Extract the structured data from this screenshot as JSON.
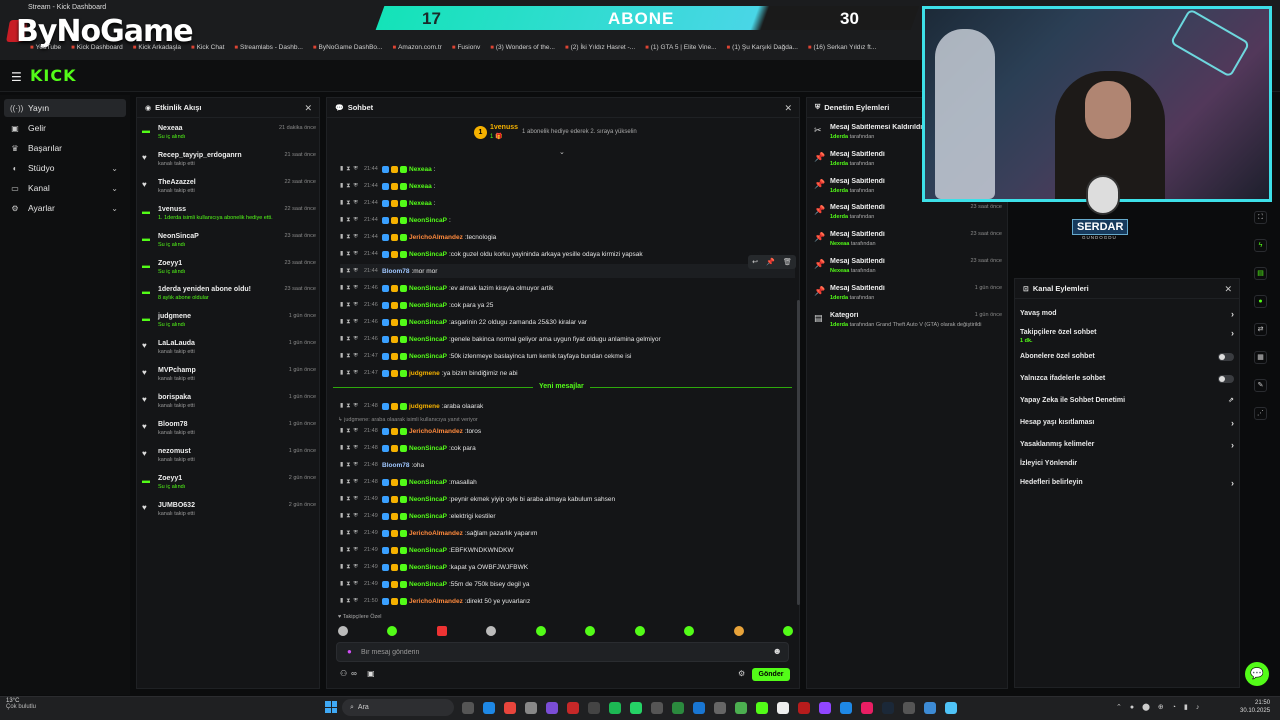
{
  "browser": {
    "tab_title": "Stream - Kick Dashboard",
    "logo_text": "ByNoGame",
    "bookmarks": [
      "YouTube",
      "Kick Dashboard",
      "Kick Arkadaşla",
      "Kick Chat",
      "Streamlabs - Dashb...",
      "ByNoGame DashBo...",
      "Amazon.com.tr",
      "Fusionv",
      "(3) Wonders of the...",
      "(2) İki Yıldız Hasret -...",
      "(1) GTA 5 | Elite Vine...",
      "(1) Şu Karşıki Dağda...",
      "(16) Serkan Yıldız ft..."
    ]
  },
  "sub_goal": {
    "current": "17",
    "label": "ABONE",
    "target": "30"
  },
  "kick": {
    "logo": "KICK"
  },
  "nav": {
    "items": [
      {
        "label": "Yayın",
        "icon": "broadcast-icon",
        "active": true
      },
      {
        "label": "Gelir",
        "icon": "wallet-icon"
      },
      {
        "label": "Başarılar",
        "icon": "trophy-icon"
      },
      {
        "label": "Stüdyo",
        "icon": "studio-icon",
        "chevron": true
      },
      {
        "label": "Kanal",
        "icon": "channel-icon",
        "chevron": true
      },
      {
        "label": "Ayarlar",
        "icon": "settings-icon",
        "chevron": true
      }
    ]
  },
  "activity": {
    "title": "Etkinlik Akışı",
    "items": [
      {
        "name": "Nexeaa",
        "sub": "Su iç alındı",
        "time": "21 dakika önce",
        "green": true
      },
      {
        "name": "Recep_tayyip_erdoganrn",
        "sub": "kanalı takip etti",
        "time": "21 saat önce"
      },
      {
        "name": "TheAzazzel",
        "sub": "kanalı takip etti",
        "time": "22 saat önce"
      },
      {
        "name": "1venuss",
        "sub": "1. 1derda isimli kullanıcıya abonelik hediye etti.",
        "time": "22 saat önce",
        "green": true
      },
      {
        "name": "NeonSincaP",
        "sub": "Su iç alındı",
        "time": "23 saat önce",
        "green": true
      },
      {
        "name": "Zoeyy1",
        "sub": "Su iç alındı",
        "time": "23 saat önce",
        "green": true
      },
      {
        "name": "1derda yeniden abone oldu!",
        "sub": "8 aylık abone oldular",
        "time": "23 saat önce",
        "green": true
      },
      {
        "name": "judgmene",
        "sub": "Su iç alındı",
        "time": "1 gün önce",
        "green": true
      },
      {
        "name": "LaLaLauda",
        "sub": "kanalı takip etti",
        "time": "1 gün önce"
      },
      {
        "name": "MVPchamp",
        "sub": "kanalı takip etti",
        "time": "1 gün önce"
      },
      {
        "name": "borispaka",
        "sub": "kanalı takip etti",
        "time": "1 gün önce"
      },
      {
        "name": "Bloom78",
        "sub": "kanalı takip etti",
        "time": "1 gün önce"
      },
      {
        "name": "nezomust",
        "sub": "kanalı takip etti",
        "time": "1 gün önce"
      },
      {
        "name": "Zoeyy1",
        "sub": "Su iç alındı",
        "time": "2 gün önce",
        "green": true
      },
      {
        "name": "JUMBO632",
        "sub": "kanalı takip etti",
        "time": "2 gün önce"
      }
    ]
  },
  "chat": {
    "title": "Sohbet",
    "pinned": {
      "badge": "1",
      "name": "1venuss",
      "count": "1 🎁",
      "message": "1 abonelik hediye ederek 2. sıraya yükselin"
    },
    "messages": [
      {
        "time": "21:44",
        "user": "Nexeaa",
        "color": "#53fc18",
        "text": ""
      },
      {
        "time": "21:44",
        "user": "Nexeaa",
        "color": "#53fc18",
        "text": ""
      },
      {
        "time": "21:44",
        "user": "Nexeaa",
        "color": "#53fc18",
        "text": ""
      },
      {
        "time": "21:44",
        "user": "NeonSincaP",
        "color": "#53fc18",
        "text": ""
      },
      {
        "time": "21:44",
        "user": "JerichoAlmandez",
        "color": "#ff8a3d",
        "text": "tecnologia"
      },
      {
        "time": "21:44",
        "user": "NeonSincaP",
        "color": "#53fc18",
        "text": "cok guzel oldu korku yayininda arkaya yesille odaya kirmizi yapsak"
      },
      {
        "time": "21:44",
        "user": "Bloom78",
        "color": "#9fc7ff",
        "text": "mor mor"
      },
      {
        "time": "21:46",
        "user": "NeonSincaP",
        "color": "#53fc18",
        "text": "ev almak lazim kirayla olmuyor artik"
      },
      {
        "time": "21:46",
        "user": "NeonSincaP",
        "color": "#53fc18",
        "text": "cok para ya 25"
      },
      {
        "time": "21:46",
        "user": "NeonSincaP",
        "color": "#53fc18",
        "text": "asgarinin 22 oldugu zamanda 25&30 kiralar var"
      },
      {
        "time": "21:46",
        "user": "NeonSincaP",
        "color": "#53fc18",
        "text": "genele bakinca normal geliyor ama uygun fiyat oldugu anlamina gelmiyor"
      },
      {
        "time": "21:47",
        "user": "NeonSincaP",
        "color": "#53fc18",
        "text": "50k izlenmeye baslayinca tum kemik tayfaya bundan cekme isi"
      },
      {
        "time": "21:47",
        "user": "judgmene",
        "color": "#f5b100",
        "text": "ya bizim bindiğimiz ne abi"
      },
      {
        "time": "21:48",
        "user": "judgmene",
        "color": "#f5b100",
        "text": "araba olaarak"
      },
      {
        "time": "21:48",
        "user": "JerichoAlmandez",
        "color": "#ff8a3d",
        "text": "toros"
      },
      {
        "time": "21:48",
        "user": "NeonSincaP",
        "color": "#53fc18",
        "text": "cok para"
      },
      {
        "time": "21:48",
        "user": "Bloom78",
        "color": "#9fc7ff",
        "text": "oha"
      },
      {
        "time": "21:48",
        "user": "NeonSincaP",
        "color": "#53fc18",
        "text": "masallah"
      },
      {
        "time": "21:49",
        "user": "NeonSincaP",
        "color": "#53fc18",
        "text": "peynir ekmek yiyip oyle bi araba almaya kabulum sahsen"
      },
      {
        "time": "21:49",
        "user": "NeonSincaP",
        "color": "#53fc18",
        "text": "elektrigi kestiler"
      },
      {
        "time": "21:49",
        "user": "JerichoAlmandez",
        "color": "#ff8a3d",
        "text": "sağlam pazarlık yaparım"
      },
      {
        "time": "21:49",
        "user": "NeonSincaP",
        "color": "#53fc18",
        "text": "EBFKWNDKWNDKW"
      },
      {
        "time": "21:49",
        "user": "NeonSincaP",
        "color": "#53fc18",
        "text": "kapat ya OWBFJWJFBWK"
      },
      {
        "time": "21:49",
        "user": "NeonSincaP",
        "color": "#53fc18",
        "text": "55m de 750k bisey degil ya"
      },
      {
        "time": "21:50",
        "user": "JerichoAlmandez",
        "color": "#ff8a3d",
        "text": "direkt 50 ye yuvarlarız"
      }
    ],
    "reply_line": "↳ judgmene: araba olaarak isimli kullanıcıya yanıt veriyor",
    "new_messages": "Yeni mesajlar",
    "followers_only": "Takipçilere Özel",
    "input_placeholder": "Bir mesaj gönderin",
    "send_label": "Gönder"
  },
  "moderation": {
    "title": "Denetim Eylemleri",
    "items": [
      {
        "title": "Mesaj Sabitlemesi Kaldırıldı",
        "by": "1derda",
        "suffix": "tarafından",
        "time": "",
        "icon": "unpin-icon"
      },
      {
        "title": "Mesaj Sabitlendi",
        "by": "1derda",
        "suffix": "tarafından",
        "time": "",
        "icon": "pin-icon"
      },
      {
        "title": "Mesaj Sabitlendi",
        "by": "1derda",
        "suffix": "tarafından",
        "time": "",
        "icon": "pin-icon"
      },
      {
        "title": "Mesaj Sabitlendi",
        "by": "1derda",
        "suffix": "tarafından",
        "time": "23 saat önce",
        "icon": "pin-icon"
      },
      {
        "title": "Mesaj Sabitlendi",
        "by": "Nexeaa",
        "suffix": "tarafından",
        "time": "23 saat önce",
        "icon": "pin-icon"
      },
      {
        "title": "Mesaj Sabitlendi",
        "by": "Nexeaa",
        "suffix": "tarafından",
        "time": "23 saat önce",
        "icon": "pin-icon"
      },
      {
        "title": "Mesaj Sabitlendi",
        "by": "1derda",
        "suffix": "tarafından",
        "time": "1 gün önce",
        "icon": "pin-icon"
      },
      {
        "title": "Kategori",
        "by": "1derda",
        "suffix": "tarafından Grand Theft Auto V (GTA) olarak değiştirildi",
        "time": "1 gün önce",
        "icon": "category-icon"
      }
    ]
  },
  "overlay": {
    "name": "SERDAR",
    "sub": "GUNDOGDU"
  },
  "channel_actions": {
    "title": "Kanal Eylemleri",
    "items": [
      {
        "label": "Yavaş mod",
        "type": "arrow"
      },
      {
        "label": "Takipçilere özel sohbet",
        "sub": "1 dk.",
        "type": "arrow"
      },
      {
        "label": "Abonelere özel sohbet",
        "type": "toggle"
      },
      {
        "label": "Yalnızca ifadelerle sohbet",
        "type": "toggle"
      },
      {
        "label": "Yapay Zeka ile Sohbet Denetimi",
        "type": "link"
      },
      {
        "label": "Hesap yaşı kısıtlaması",
        "type": "arrow"
      },
      {
        "label": "Yasaklanmış kelimeler",
        "type": "arrow"
      },
      {
        "label": "İzleyici Yönlendir",
        "type": "none"
      },
      {
        "label": "Hedefleri belirleyin",
        "type": "arrow"
      }
    ]
  },
  "taskbar": {
    "weather_temp": "13°C",
    "weather_desc": "Çok bulutlu",
    "search": "Ara",
    "time": "21:50",
    "date": "30.10.2025"
  }
}
